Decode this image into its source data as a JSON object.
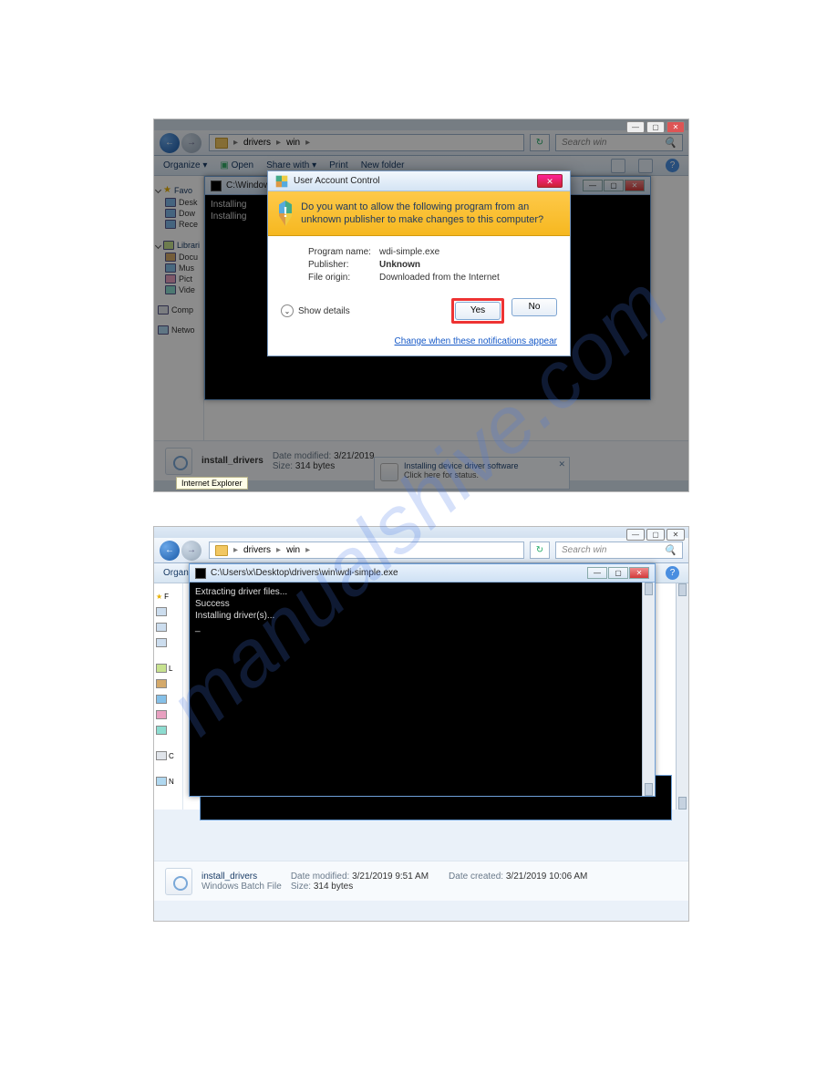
{
  "watermark": "manualshive.com",
  "shot1": {
    "winctrls": {
      "min": "—",
      "max": "▢",
      "close": "✕"
    },
    "nav": {
      "back": "←",
      "fwd": "→"
    },
    "breadcrumb": {
      "p1": "drivers",
      "p2": "win",
      "sep": "▸"
    },
    "refresh": "↻",
    "search": {
      "placeholder": "Search win",
      "icon": "🔍"
    },
    "toolbar": {
      "organize": "Organize ▾",
      "open": "Open",
      "share": "Share with ▾",
      "print": "Print",
      "newfolder": "New folder"
    },
    "sidebar": {
      "fav": "Favo",
      "desk": "Desk",
      "dow": "Dow",
      "rece": "Rece",
      "lib": "Librari",
      "docu": "Docu",
      "mus": "Mus",
      "pict": "Pict",
      "vide": "Vide",
      "comp": "Comp",
      "netwo": "Netwo"
    },
    "console": {
      "titlePrefix": "C:\\Windows",
      "l1": "Installing",
      "l2": "Installing"
    },
    "uac": {
      "title": "User Account Control",
      "x": "✕",
      "message": "Do you want to allow the following program from an unknown publisher to make changes to this computer?",
      "programLabel": "Program name:",
      "program": "wdi-simple.exe",
      "publisherLabel": "Publisher:",
      "publisher": "Unknown",
      "originLabel": "File origin:",
      "origin": "Downloaded from the Internet",
      "showdetails": "Show details",
      "yes": "Yes",
      "no": "No",
      "link": "Change when these notifications appear"
    },
    "details": {
      "name": "install_drivers",
      "type": "",
      "modifiedLabel": "Date modified:",
      "modified": "3/21/2019",
      "sizeLabel": "Size:",
      "size": "314 bytes"
    },
    "ieTooltip": "Internet Explorer",
    "notif": {
      "title": "Installing device driver software",
      "sub": "Click here for status."
    }
  },
  "shot2": {
    "winctrls": {
      "min": "—",
      "max": "▢",
      "close": "✕"
    },
    "nav": {
      "back": "←",
      "fwd": "→"
    },
    "breadcrumb": {
      "p1": "drivers",
      "p2": "win",
      "sep": "▸"
    },
    "refresh": "↻",
    "search": {
      "placeholder": "Search win",
      "icon": "🔍"
    },
    "toolbar": {
      "organize": "Organ"
    },
    "console": {
      "title": "C:\\Users\\x\\Desktop\\drivers\\win\\wdi-simple.exe",
      "l1": "Extracting driver files...",
      "l2": "   Success",
      "l3": "Installing driver(s)...",
      "l4": "_"
    },
    "sidebar": {
      "f": "F",
      "l": "L",
      "c": "C",
      "n": "N"
    },
    "details": {
      "name": "install_drivers",
      "type": "Windows Batch File",
      "modifiedLabel": "Date modified:",
      "modified": "3/21/2019 9:51 AM",
      "sizeLabel": "Size:",
      "size": "314 bytes",
      "createdLabel": "Date created:",
      "created": "3/21/2019 10:06 AM"
    }
  }
}
